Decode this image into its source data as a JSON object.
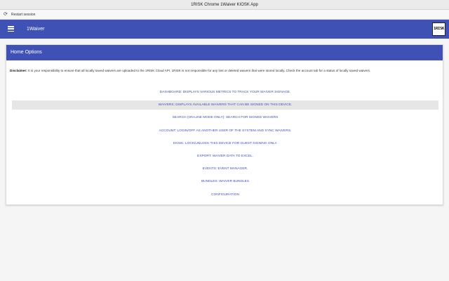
{
  "window": {
    "title": "1RISK Chrome 1Waiver KIOSK App"
  },
  "menubar": {
    "restart_icon": "restart-icon",
    "restart_label": "Restart session"
  },
  "appbar": {
    "menu_icon": "hamburger-menu-icon",
    "title": "1Waiver",
    "logo_text": "1RISK"
  },
  "colors": {
    "primary": "#3f51b5",
    "link": "#3f51b5",
    "highlight": "#e6e6e6"
  },
  "card": {
    "header": "Home Options",
    "disclaimer_label": "Disclaimer:",
    "disclaimer_text": " It is your responsibility to ensure that all locally saved waivers are uploaded to the 1RISK Cloud API. 1RISK is not responsible for any lost or deleted waivers that were stored locally. Check the account tab for a status of locally saved waivers."
  },
  "options": [
    {
      "label": "DASHBOARD: DISPLAYS VARIOUS METRICS TO TRACK YOUR WAIVER SIGNAGE."
    },
    {
      "label": "WAIVERS: DISPLAYS AVAILABLE WAIVERS THAT CAN BE SIGNED ON THIS DEVICE."
    },
    {
      "label": "SEARCH (ON-LINE MODE ONLY): SEARCH FOR SIGNED WAIVERS"
    },
    {
      "label": "ACCOUNT: LOGIN/OFF AS ANOTHER USER OF THE SYSTEM AND SYNC WAIVERS."
    },
    {
      "label": "KIOSK: LOCK/UNLOCK THIS DEVICE FOR GUEST SIGNING ONLY."
    },
    {
      "label": "EXPORT: WAIVER DATA TO EXCEL."
    },
    {
      "label": "EVENTS: EVENT MANAGER."
    },
    {
      "label": "BUNDLES: WAIVER BUNDLES"
    },
    {
      "label": "CONFIGURATION"
    }
  ]
}
